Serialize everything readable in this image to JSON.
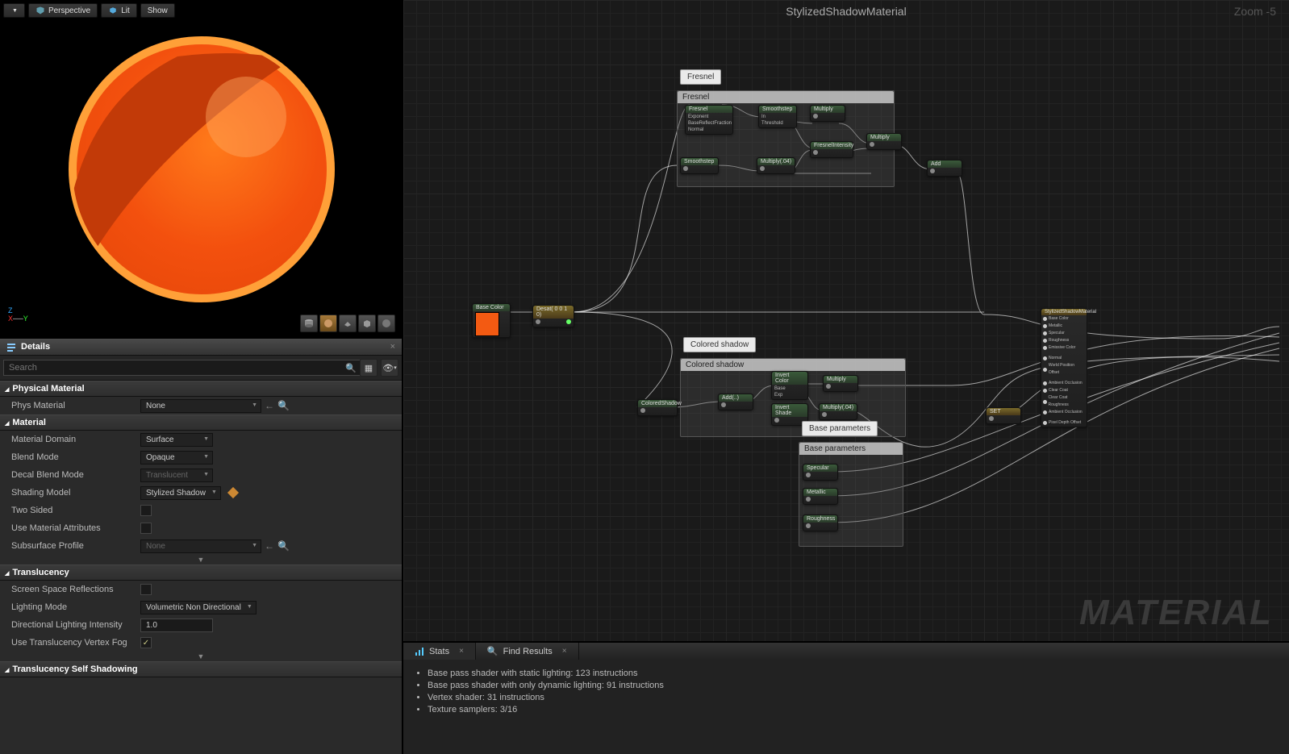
{
  "viewport": {
    "perspective_label": "Perspective",
    "lit_label": "Lit",
    "show_label": "Show"
  },
  "details": {
    "title": "Details",
    "search_placeholder": "Search",
    "sections": {
      "physical": "Physical Material",
      "material": "Material",
      "translucency": "Translucency",
      "tss": "Translucency Self Shadowing"
    },
    "props": {
      "phys_material": {
        "label": "Phys Material",
        "value": "None"
      },
      "material_domain": {
        "label": "Material Domain",
        "value": "Surface"
      },
      "blend_mode": {
        "label": "Blend Mode",
        "value": "Opaque"
      },
      "decal_blend_mode": {
        "label": "Decal Blend Mode",
        "value": "Translucent"
      },
      "shading_model": {
        "label": "Shading Model",
        "value": "Stylized Shadow"
      },
      "two_sided": {
        "label": "Two Sided"
      },
      "use_mat_attrs": {
        "label": "Use Material Attributes"
      },
      "subsurface_profile": {
        "label": "Subsurface Profile",
        "value": "None"
      },
      "ssr": {
        "label": "Screen Space Reflections"
      },
      "lighting_mode": {
        "label": "Lighting Mode",
        "value": "Volumetric Non Directional"
      },
      "dli": {
        "label": "Directional Lighting Intensity",
        "value": "1.0"
      },
      "tvf": {
        "label": "Use Translucency Vertex Fog"
      }
    }
  },
  "graph": {
    "title": "StylizedShadowMaterial",
    "zoom": "Zoom -5",
    "bg": "MATERIAL",
    "comments": {
      "fresnel": "Fresnel",
      "colored_shadow": "Colored shadow",
      "base_params": "Base parameters"
    },
    "tooltips": {
      "fresnel": "Fresnel",
      "colored_shadow": "Colored shadow",
      "base_params": "Base parameters"
    },
    "nodes": {
      "base_color": "Base Color",
      "desat": "Desat( 0 0 1 0)",
      "fresnel": "Fresnel",
      "exponent": "Exponent",
      "brf": "BaseReflectFraction",
      "normal": "Normal",
      "smoothstep": "Smoothstep",
      "in": "In",
      "threshold": "Threshold",
      "multiply": "Multiply",
      "multiply04": "Multiply(.04)",
      "fresnel_intensity": "FresnelIntensity",
      "add": "Add",
      "colored_shadow": "ColoredShadow",
      "add2": "Add(..)",
      "invert_color": "Invert Color",
      "base": "Base",
      "exp": "Exp",
      "invert_shade": "Invert Shade",
      "multiply2": "Multiply",
      "multiply04b": "Multiply(.04)",
      "specular": "Specular",
      "metallic": "Metallic",
      "roughness": "Roughness",
      "set": "SET",
      "result_title": "StylizedShadowMaterial",
      "r_basecolor": "Base Color",
      "r_metallic": "Metallic",
      "r_specular": "Specular",
      "r_roughness": "Roughness",
      "r_emissive": "Emissive Color",
      "r_normal": "Normal",
      "r_wpo": "World Position Offset",
      "r_ao": "Ambient Occlusion",
      "r_clearcoat": "Clear Coat",
      "r_ccr": "Clear Coat Roughness",
      "r_ao2": "Ambient Occlusion",
      "r_pdo": "Pixel Depth Offset"
    }
  },
  "bottom": {
    "stats_tab": "Stats",
    "find_tab": "Find Results",
    "lines": [
      "Base pass shader with static lighting: 123 instructions",
      "Base pass shader with only dynamic lighting: 91 instructions",
      "Vertex shader: 31 instructions",
      "Texture samplers: 3/16"
    ]
  }
}
